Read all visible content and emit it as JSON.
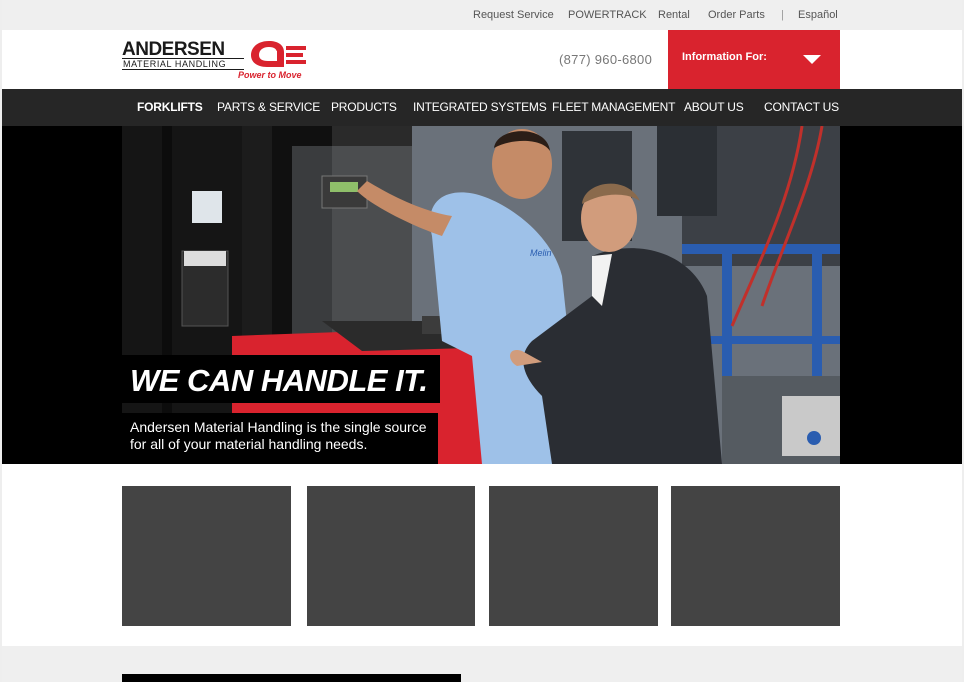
{
  "utility_nav": {
    "items": [
      "Request Service",
      "POWERTRACK",
      "Rental",
      "Order Parts"
    ],
    "separator": "|",
    "language": "Español"
  },
  "header": {
    "logo_line1": "ANDERSEN",
    "logo_line2": "MATERIAL HANDLING",
    "logo_tagline": "Power to Move",
    "phone": "(877) 960-6800",
    "info_for_label": "Information For:"
  },
  "main_nav": {
    "items": [
      "FORKLIFTS",
      "PARTS & SERVICE",
      "PRODUCTS",
      "INTEGRATED SYSTEMS",
      "FLEET MANAGEMENT",
      "ABOUT US",
      "CONTACT US"
    ],
    "active": "FORKLIFTS"
  },
  "hero": {
    "headline": "WE CAN HANDLE IT.",
    "subtext": "Andersen Material Handling is the single source for all of your material handling needs.",
    "shirt_logo": "Melin"
  },
  "tiles_count": 4,
  "colors": {
    "brand_red": "#d9232e",
    "nav_bg": "#262626",
    "tile_bg": "#444444"
  }
}
